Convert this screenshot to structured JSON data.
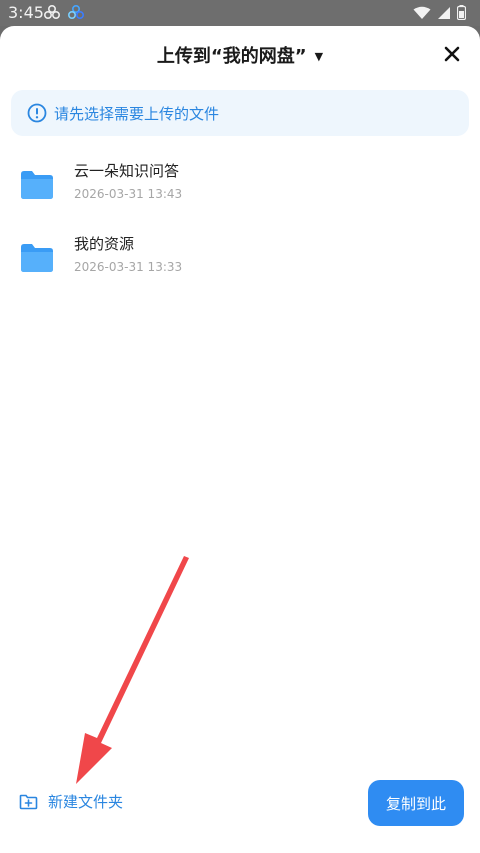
{
  "status_bar": {
    "time": "3:45"
  },
  "sheet": {
    "title": "上传到“我的网盘”",
    "notice": "请先选择需要上传的文件",
    "files": [
      {
        "name": "云一朵知识问答",
        "date": "2026-03-31  13:43"
      },
      {
        "name": "我的资源",
        "date": "2026-03-31  13:33"
      }
    ],
    "new_folder_label": "新建文件夹",
    "copy_button_label": "复制到此"
  },
  "colors": {
    "accent": "#2f8cf2",
    "notice_bg": "#eef6fd",
    "arrow": "#f0474a"
  }
}
